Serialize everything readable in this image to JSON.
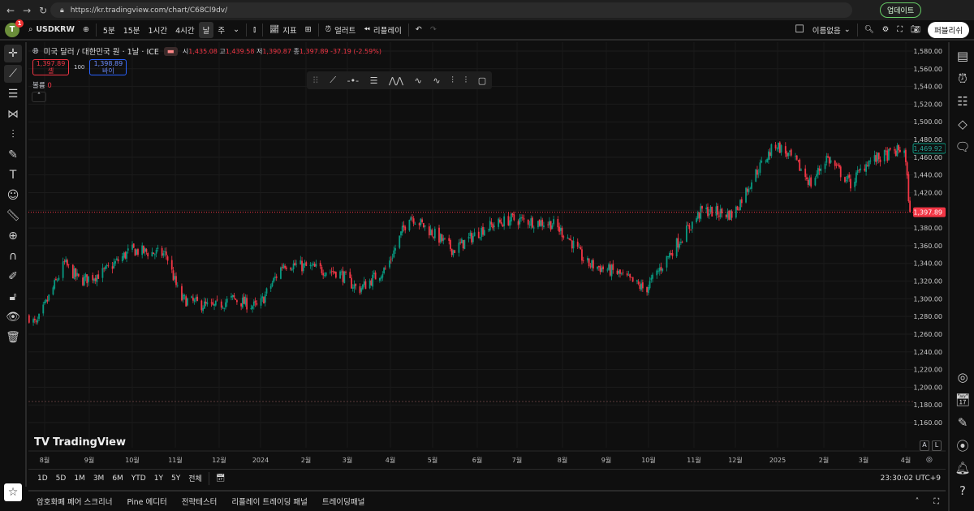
{
  "browser": {
    "url": "https://kr.tradingview.com/chart/C68Cl9dv/",
    "update_label": "업데이트"
  },
  "toolbar": {
    "avatar": "T",
    "badge": "1",
    "symbol": "USDKRW",
    "intervals": [
      "5분",
      "15분",
      "1시간",
      "4시간",
      "날",
      "주"
    ],
    "active_interval": "날",
    "indicators": "지표",
    "alert": "얼러트",
    "replay": "리플레이",
    "layout_name": "이름없음",
    "publish": "퍼블리쉬"
  },
  "legend": {
    "title": "미국 달러 / 대한민국 원 · 1날 · ICE",
    "o_label": "시",
    "o": "1,435.08",
    "h_label": "고",
    "h": "1,439.58",
    "l_label": "저",
    "l": "1,390.87",
    "c_label": "종",
    "c": "1,397.89",
    "change": "-37.19 (-2.59%)",
    "sell_price": "1,397.89",
    "sell_label": "셀",
    "spread": "100",
    "buy_price": "1,398.89",
    "buy_label": "바이",
    "volume_label": "볼륨",
    "volume": "0"
  },
  "colors": {
    "up": "#089981",
    "down": "#f23645",
    "bg": "#0f0f0f"
  },
  "chart_data": {
    "type": "candlestick",
    "ylim": [
      1150,
      1590
    ],
    "yticks": [
      "1,580.00",
      "1,560.00",
      "1,540.00",
      "1,520.00",
      "1,500.00",
      "1,480.00",
      "1,460.00",
      "1,440.00",
      "1,420.00",
      "1,400.00",
      "1,380.00",
      "1,360.00",
      "1,340.00",
      "1,320.00",
      "1,300.00",
      "1,280.00",
      "1,260.00",
      "1,240.00",
      "1,220.00",
      "1,200.00",
      "1,180.00",
      "1,160.00"
    ],
    "xticks": [
      "8월",
      "9월",
      "10월",
      "11월",
      "12월",
      "2024",
      "2월",
      "3월",
      "4월",
      "5월",
      "6월",
      "7월",
      "8월",
      "9월",
      "10월",
      "11월",
      "12월",
      "2025",
      "2월",
      "3월",
      "4월"
    ],
    "approx_close_path": [
      [
        "2023-07-21",
        1280
      ],
      [
        "2023-07-26",
        1270
      ],
      [
        "2023-08-15",
        1340
      ],
      [
        "2023-08-26",
        1320
      ],
      [
        "2023-09-12",
        1330
      ],
      [
        "2023-10-01",
        1355
      ],
      [
        "2023-10-26",
        1350
      ],
      [
        "2023-11-05",
        1300
      ],
      [
        "2023-11-28",
        1290
      ],
      [
        "2023-12-12",
        1300
      ],
      [
        "2023-12-30",
        1290
      ],
      [
        "2024-01-17",
        1340
      ],
      [
        "2024-02-25",
        1330
      ],
      [
        "2024-03-10",
        1310
      ],
      [
        "2024-03-30",
        1335
      ],
      [
        "2024-04-15",
        1395
      ],
      [
        "2024-05-05",
        1370
      ],
      [
        "2024-05-16",
        1355
      ],
      [
        "2024-06-07",
        1380
      ],
      [
        "2024-06-26",
        1390
      ],
      [
        "2024-07-25",
        1385
      ],
      [
        "2024-08-05",
        1370
      ],
      [
        "2024-08-18",
        1340
      ],
      [
        "2024-09-08",
        1330
      ],
      [
        "2024-09-29",
        1310
      ],
      [
        "2024-10-20",
        1360
      ],
      [
        "2024-11-08",
        1400
      ],
      [
        "2024-11-30",
        1395
      ],
      [
        "2024-12-15",
        1440
      ],
      [
        "2024-12-30",
        1475
      ],
      [
        "2025-01-13",
        1455
      ],
      [
        "2025-01-24",
        1430
      ],
      [
        "2025-02-04",
        1460
      ],
      [
        "2025-02-21",
        1430
      ],
      [
        "2025-03-05",
        1455
      ],
      [
        "2025-03-15",
        1460
      ],
      [
        "2025-03-31",
        1470
      ],
      [
        "2025-04-04",
        1397.89
      ]
    ],
    "last_price_label": "1,397.89",
    "previous_close_label": "1,469.92",
    "grid": true
  },
  "watermark": "TradingView",
  "axis_buttons": {
    "auto": "A",
    "log": "L"
  },
  "ranges": [
    "1D",
    "5D",
    "1M",
    "3M",
    "6M",
    "YTD",
    "1Y",
    "5Y",
    "전체"
  ],
  "clock": "23:30:02 UTC+9",
  "panel": [
    "암호화폐 페어 스크리너",
    "Pine 에디터",
    "전략테스터",
    "리플레이 트레이딩 패널",
    "트레이딩패널"
  ]
}
